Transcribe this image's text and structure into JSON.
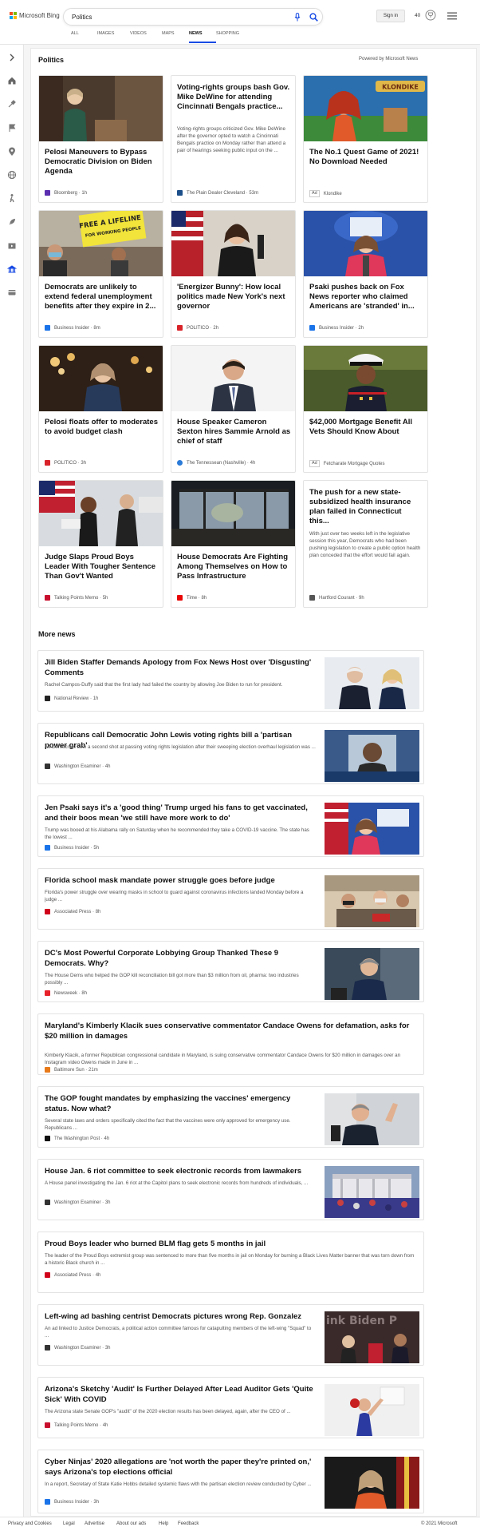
{
  "header": {
    "brand": "Microsoft Bing",
    "search_value": "Politics",
    "signin_label": "Sign in",
    "points": "40",
    "tabs": [
      "ALL",
      "IMAGES",
      "VIDEOS",
      "MAPS",
      "NEWS",
      "SHOPPING"
    ],
    "active_tab": "NEWS"
  },
  "politics": {
    "title": "Politics",
    "powered_by": "Powered by Microsoft News",
    "cards": [
      {
        "title": "Pelosi Maneuvers to Bypass Democratic Division on Biden Agenda",
        "source": "Bloomberg",
        "time": "1h",
        "snippet": ""
      },
      {
        "title": "Voting-rights groups bash Gov. Mike DeWine for attending Cincinnati Bengals practice...",
        "snippet": "Voting-rights groups criticized Gov. Mike DeWine after the governor opted to watch a Cincinnati Bengals practice on Monday rather than attend a pair of hearings seeking public input on the ...",
        "source": "The Plain Dealer Cleveland",
        "time": "53m"
      },
      {
        "title": "The No.1 Quest Game of 2021! No Download Needed",
        "source": "Klondike",
        "ad": "Ad",
        "snippet": "",
        "image_text": "KLONDIKE"
      },
      {
        "title": "Democrats are unlikely to extend federal unemployment benefits after they expire in 2...",
        "source": "Business Insider",
        "time": "8m",
        "snippet": "",
        "image_text": "FREE A LIFELINE",
        "image_text2": "FOR WORKING PEOPLE"
      },
      {
        "title": "'Energizer Bunny': How local politics made New York's next governor",
        "source": "POLITICO",
        "time": "2h",
        "snippet": ""
      },
      {
        "title": "Psaki pushes back on Fox News reporter who claimed Americans are 'stranded' in...",
        "source": "Business Insider",
        "time": "2h",
        "snippet": ""
      },
      {
        "title": "Pelosi floats offer to moderates to avoid budget clash",
        "source": "POLITICO",
        "time": "3h",
        "snippet": ""
      },
      {
        "title": "House Speaker Cameron Sexton hires Sammie Arnold as chief of staff",
        "source": "The Tennessean (Nashville)",
        "time": "4h",
        "snippet": ""
      },
      {
        "title": "$42,000 Mortgage Benefit All Vets Should Know About",
        "source": "Fetcharate Mortgage Quotes",
        "ad": "Ad",
        "snippet": ""
      },
      {
        "title": "Judge Slaps Proud Boys Leader With Tougher Sentence Than Gov't Wanted",
        "source": "Talking Points Memo",
        "time": "5h",
        "snippet": ""
      },
      {
        "title": "House Democrats Are Fighting Among Themselves on How to Pass Infrastructure",
        "source": "Time",
        "time": "8h",
        "snippet": ""
      },
      {
        "title": "The push for a new state-subsidized health insurance plan failed in Connecticut this...",
        "snippet": "With just over two weeks left in the legislative session this year, Democrats who had been pushing legislation to create a public option health plan conceded that the effort would fail again.",
        "source": "Hartford Courant",
        "time": "9h"
      }
    ]
  },
  "more_news": {
    "title": "More news",
    "items": [
      {
        "title": "Jill Biden Staffer Demands Apology from Fox News Host over 'Disgusting' Comments",
        "snippet": "Rachel Campos-Duffy said that the first lady had failed the country by allowing Joe Biden to run for president.",
        "source": "National Review",
        "time": "1h"
      },
      {
        "title": "Republicans call Democratic John Lewis voting rights bill a 'partisan power grab'",
        "snippet": "As Democrats take a second shot at passing voting rights legislation after their sweeping election overhaul legislation was ...",
        "source": "Washington Examiner",
        "time": "4h"
      },
      {
        "title": "Jen Psaki says it's a 'good thing' Trump urged his fans to get vaccinated, and their boos mean 'we still have more work to do'",
        "snippet": "Trump was booed at his Alabama rally on Saturday when he recommended they take a COVID-19 vaccine. The state has the lowest ...",
        "source": "Business Insider",
        "time": "5h"
      },
      {
        "title": "Florida school mask mandate power struggle goes before judge",
        "snippet": "Florida's power struggle over wearing masks in school to guard against coronavirus infections landed Monday before a judge ...",
        "source": "Associated Press",
        "time": "8h"
      },
      {
        "title": "DC's Most Powerful Corporate Lobbying Group Thanked These 9 Democrats. Why?",
        "snippet": "The House Dems who helped the GOP kill reconciliation bill got more than $3 million from oil, pharma: two industries possibly ...",
        "source": "Newsweek",
        "time": "8h"
      },
      {
        "title": "Maryland's Kimberly Klacik sues conservative commentator Candace Owens for defamation, asks for $20 million in damages",
        "snippet": "Kimberly Klacik, a former Republican congressional candidate in Maryland, is suing conservative commentator Candace Owens for $20 million in damages over an Instagram video Owens made in June in ...",
        "source": "Baltimore Sun",
        "time": "21m"
      },
      {
        "title": "The GOP fought mandates by emphasizing the vaccines' emergency status. Now what?",
        "snippet": "Several state laws and orders specifically cited the fact that the vaccines were only approved for emergency use. Republicans ...",
        "source": "The Washington Post",
        "time": "4h"
      },
      {
        "title": "House Jan. 6 riot committee to seek electronic records from lawmakers",
        "snippet": "A House panel investigating the Jan. 6 riot at the Capitol plans to seek electronic records from hundreds of individuals, ...",
        "source": "Washington Examiner",
        "time": "3h"
      },
      {
        "title": "Proud Boys leader who burned BLM flag gets 5 months in jail",
        "snippet": "The leader of the Proud Boys extremist group was sentenced to more than five months in jail on Monday for burning a Black Lives Matter banner that was torn down from a historic Black church in ...",
        "source": "Associated Press",
        "time": "4h"
      },
      {
        "title": "Left-wing ad bashing centrist Democrats pictures wrong Rep. Gonzalez",
        "snippet": "An ad linked to Justice Democrats, a political action committee famous for catapulting members of the left-wing \"Squad\" to ...",
        "source": "Washington Examiner",
        "time": "3h",
        "image_text": "ink Biden P"
      },
      {
        "title": "Arizona's Sketchy 'Audit' Is Further Delayed After Lead Auditor Gets 'Quite Sick' With COVID",
        "snippet": "The Arizona state Senate GOP's \"audit\" of the 2020 election results has been delayed, again, after the CEO of ...",
        "source": "Talking Points Memo",
        "time": "4h"
      },
      {
        "title": "Cyber Ninjas' 2020 allegations are 'not worth the paper they're printed on,' says Arizona's top elections official",
        "snippet": "In a report, Secretary of State Katie Hobbs detailed systemic flaws with the partisan election review conducted by Cyber ...",
        "source": "Business Insider",
        "time": "3h"
      }
    ]
  },
  "footer": {
    "links": [
      "Privacy and Cookies",
      "Legal",
      "Advertise",
      "About our ads",
      "Help",
      "Feedback"
    ],
    "copyright": "© 2021 Microsoft"
  },
  "colors": {
    "accent": "#174ae4",
    "ms_red": "#f25022",
    "ms_green": "#7fba00",
    "ms_blue": "#00a4ef",
    "ms_yellow": "#ffb900"
  }
}
